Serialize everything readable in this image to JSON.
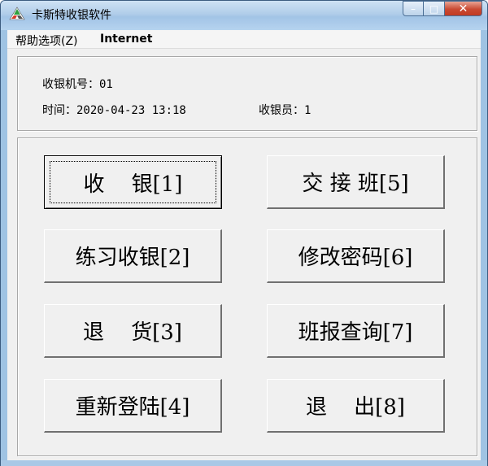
{
  "window": {
    "title": "卡斯特收银软件",
    "controls": {
      "minimize": "–",
      "maximize": "□",
      "close": "✕"
    }
  },
  "menu": {
    "items": [
      "帮助选项(Z)",
      "Internet"
    ]
  },
  "info": {
    "register_line": "收银机号：01",
    "time_line": "时间：2020-04-23 13:18",
    "cashier_line": "收银员：1"
  },
  "buttons": {
    "cashier": "收    银[1]",
    "handover": "交 接 班[5]",
    "practice": "练习收银[2]",
    "change_password": "修改密码[6]",
    "returns": "退    货[3]",
    "shift_report": "班报查询[7]",
    "relogin": "重新登陆[4]",
    "exit": "退    出[8]"
  },
  "colors": {
    "titlebar": "#b0cde9",
    "close_button": "#c94a33",
    "client_background": "#f0f0f0",
    "app_icon_green": "#2e9e3e",
    "app_icon_red": "#d63a2a"
  }
}
